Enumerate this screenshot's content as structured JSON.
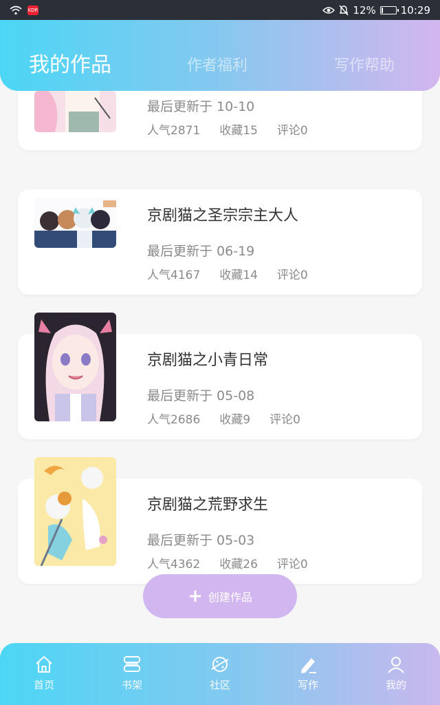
{
  "status_bar": {
    "battery": "12%",
    "battery_level": 0.12,
    "time": "10:29",
    "app_badge": "KDR"
  },
  "header": {
    "tabs": [
      {
        "label": "我的作品",
        "active": true
      },
      {
        "label": "作者福利",
        "active": false
      },
      {
        "label": "写作帮助",
        "active": false
      }
    ]
  },
  "works": [
    {
      "title": "",
      "date": "最后更新于 10-10",
      "popularity": "人气2871",
      "favorites": "收藏15",
      "comments": "评论0"
    },
    {
      "title": "京剧猫之圣宗宗主大人",
      "date": "最后更新于 06-19",
      "popularity": "人气4167",
      "favorites": "收藏14",
      "comments": "评论0"
    },
    {
      "title": "京剧猫之小青日常",
      "date": "最后更新于 05-08",
      "popularity": "人气2686",
      "favorites": "收藏9",
      "comments": "评论0"
    },
    {
      "title": "京剧猫之荒野求生",
      "date": "最后更新于 05-03",
      "popularity": "人气4362",
      "favorites": "收藏26",
      "comments": "评论0"
    }
  ],
  "create_button": {
    "label": "创建作品"
  },
  "bottom_nav": [
    {
      "label": "首页",
      "icon": "home-icon"
    },
    {
      "label": "书架",
      "icon": "bookshelf-icon"
    },
    {
      "label": "社区",
      "icon": "planet-icon"
    },
    {
      "label": "写作",
      "icon": "pen-icon",
      "active": true
    },
    {
      "label": "我的",
      "icon": "user-icon"
    }
  ],
  "colors": {
    "gradient_start": "#4cd6f5",
    "gradient_end": "#d3b6ee",
    "create_button": "#d2b6ef"
  }
}
